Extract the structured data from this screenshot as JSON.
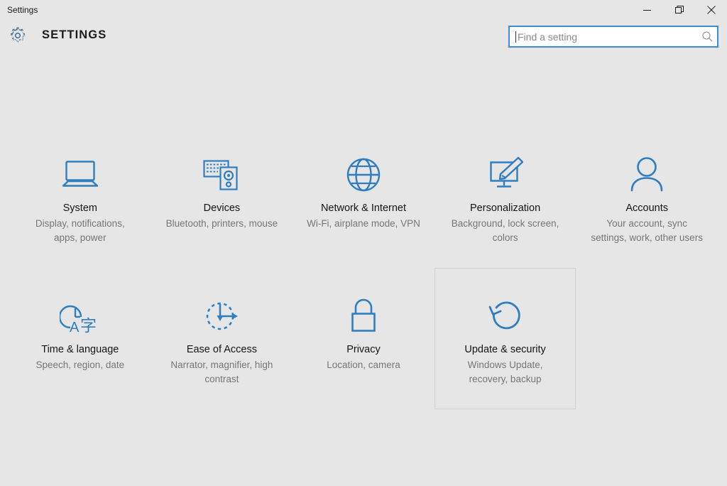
{
  "window": {
    "title": "Settings",
    "minimize_icon": "minimize-icon",
    "maximize_icon": "maximize-restore-icon",
    "close_icon": "close-icon"
  },
  "header": {
    "gear_icon": "gear-icon",
    "app_title": "SETTINGS"
  },
  "search": {
    "placeholder": "Find a setting",
    "value": "",
    "icon": "search-icon",
    "focused": true,
    "border_color": "#3b8fd4"
  },
  "colors": {
    "background": "#e6e6e6",
    "icon_blue": "#2f7ec0",
    "title_text": "#141414",
    "desc_text": "#767676",
    "tile_border": "#d2d2d2"
  },
  "tiles": [
    {
      "id": "system",
      "icon": "laptop-icon",
      "title": "System",
      "description": "Display, notifications, apps, power",
      "selected": false
    },
    {
      "id": "devices",
      "icon": "keyboard-speaker-icon",
      "title": "Devices",
      "description": "Bluetooth, printers, mouse",
      "selected": false
    },
    {
      "id": "network-internet",
      "icon": "globe-icon",
      "title": "Network & Internet",
      "description": "Wi-Fi, airplane mode, VPN",
      "selected": false
    },
    {
      "id": "personalization",
      "icon": "monitor-paintbrush-icon",
      "title": "Personalization",
      "description": "Background, lock screen, colors",
      "selected": false
    },
    {
      "id": "accounts",
      "icon": "person-icon",
      "title": "Accounts",
      "description": "Your account, sync settings, work, other users",
      "selected": false
    },
    {
      "id": "time-language",
      "icon": "clock-language-icon",
      "title": "Time & language",
      "description": "Speech, region, date",
      "selected": false
    },
    {
      "id": "ease-of-access",
      "icon": "dashed-circle-arrows-icon",
      "title": "Ease of Access",
      "description": "Narrator, magnifier, high contrast",
      "selected": false
    },
    {
      "id": "privacy",
      "icon": "padlock-icon",
      "title": "Privacy",
      "description": "Location, camera",
      "selected": false
    },
    {
      "id": "update-security",
      "icon": "refresh-circle-icon",
      "title": "Update & security",
      "description": "Windows Update, recovery, backup",
      "selected": true
    }
  ]
}
